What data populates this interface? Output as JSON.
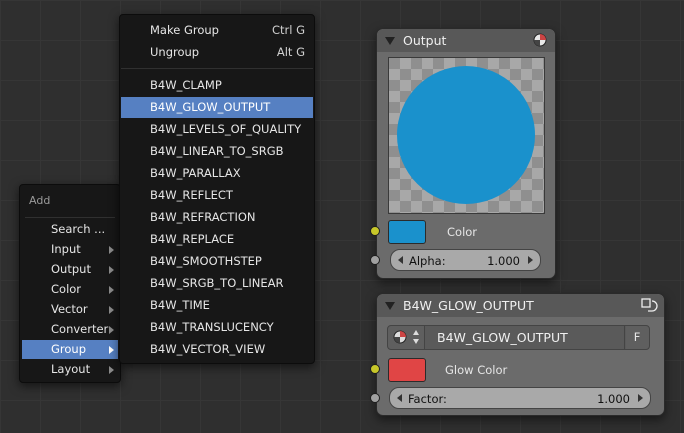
{
  "add_menu": {
    "title": "Add",
    "items": [
      {
        "label": "Search ..."
      },
      {
        "label": "Input"
      },
      {
        "label": "Output"
      },
      {
        "label": "Color"
      },
      {
        "label": "Vector"
      },
      {
        "label": "Converter"
      },
      {
        "label": "Group"
      },
      {
        "label": "Layout"
      }
    ],
    "active": "Group"
  },
  "group_menu": {
    "top_items": [
      {
        "label": "Make Group",
        "shortcut": "Ctrl G"
      },
      {
        "label": "Ungroup",
        "shortcut": "Alt G"
      }
    ],
    "groups": [
      "B4W_CLAMP",
      "B4W_GLOW_OUTPUT",
      "B4W_LEVELS_OF_QUALITY",
      "B4W_LINEAR_TO_SRGB",
      "B4W_PARALLAX",
      "B4W_REFLECT",
      "B4W_REFRACTION",
      "B4W_REPLACE",
      "B4W_SMOOTHSTEP",
      "B4W_SRGB_TO_LINEAR",
      "B4W_TIME",
      "B4W_TRANSLUCENCY",
      "B4W_VECTOR_VIEW"
    ],
    "active": "B4W_GLOW_OUTPUT"
  },
  "output_node": {
    "title": "Output",
    "color_label": "Color",
    "color_value": "#1a91cc",
    "alpha_label": "Alpha:",
    "alpha_value": "1.000"
  },
  "glow_node": {
    "title": "B4W_GLOW_OUTPUT",
    "group_name": "B4W_GLOW_OUTPUT",
    "fake_user": "F",
    "glow_color_label": "Glow Color",
    "glow_color_value": "#e04545",
    "factor_label": "Factor:",
    "factor_value": "1.000"
  },
  "colors": {
    "menu_highlight": "#5680c2",
    "socket_yellow": "#c7c729",
    "socket_grey": "#a1a1a1"
  }
}
